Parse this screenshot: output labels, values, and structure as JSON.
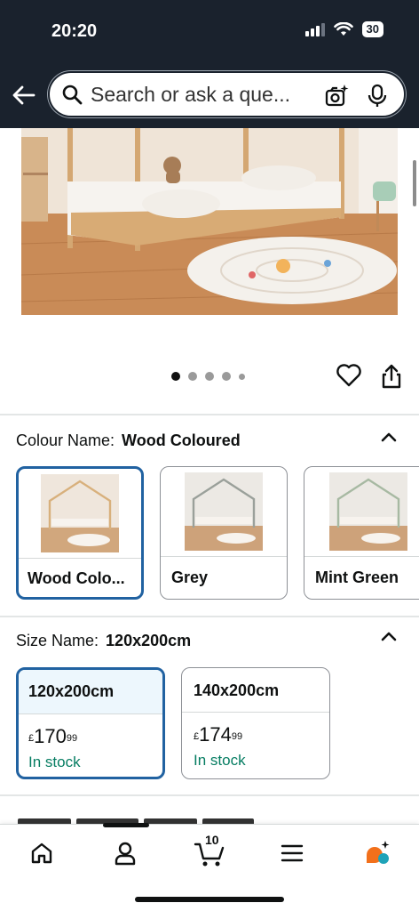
{
  "status_bar": {
    "time": "20:20",
    "battery": "30"
  },
  "header": {
    "back_icon": "arrow-left-icon",
    "search_placeholder": "Search or ask a que...",
    "camera_icon": "camera-sparkle-icon",
    "mic_icon": "microphone-icon"
  },
  "gallery": {
    "image_count": 5,
    "active_index": 0
  },
  "actions": {
    "wishlist_icon": "heart-icon",
    "share_icon": "share-icon"
  },
  "colour": {
    "label": "Colour Name:",
    "value": "Wood Coloured",
    "options": [
      {
        "label": "Wood Colo...",
        "selected": true
      },
      {
        "label": "Grey",
        "selected": false
      },
      {
        "label": "Mint Green",
        "selected": false
      }
    ]
  },
  "size": {
    "label": "Size Name:",
    "value": "120x200cm",
    "options": [
      {
        "label": "120x200cm",
        "currency": "£",
        "price_whole": "170",
        "price_fraction": "99",
        "stock": "In stock",
        "selected": true
      },
      {
        "label": "140x200cm",
        "currency": "£",
        "price_whole": "174",
        "price_fraction": "99",
        "stock": "In stock",
        "selected": false
      }
    ]
  },
  "bottom_nav": {
    "items": [
      "home-icon",
      "account-icon",
      "cart-icon",
      "menu-icon",
      "rufus-icon"
    ],
    "cart_count": "10"
  },
  "colors": {
    "header_bg": "#1a222d",
    "selected_border": "#2162a1",
    "stock_green": "#067d62",
    "rufus_orange": "#f2701b",
    "rufus_teal": "#1fa3b8"
  }
}
